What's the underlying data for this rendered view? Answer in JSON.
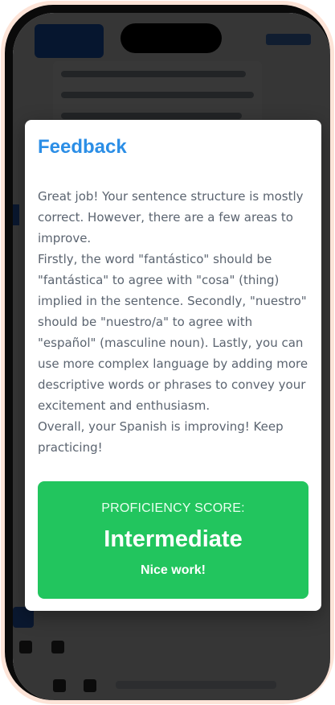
{
  "modal": {
    "title": "Feedback",
    "paragraphs": [
      "Great job! Your sentence structure is mostly correct. However, there are a few areas to improve.",
      "Firstly, the word \"fantástico\" should be \"fantástica\" to agree with \"cosa\" (thing) implied in the sentence. Secondly, \"nuestro\" should be \"nuestro/a\" to agree with \"español\" (masculine noun). Lastly, you can use more complex language by adding more descriptive words or phrases to convey your excitement and enthusiasm.",
      "Overall, your Spanish is improving! Keep practicing!"
    ]
  },
  "score": {
    "label": "PROFICIENCY SCORE:",
    "value": "Intermediate",
    "note": "Nice work!"
  },
  "colors": {
    "title": "#2b8ee6",
    "score_bg": "#22c55e",
    "body_text": "#5b6470",
    "frame": "#fde4d8"
  }
}
